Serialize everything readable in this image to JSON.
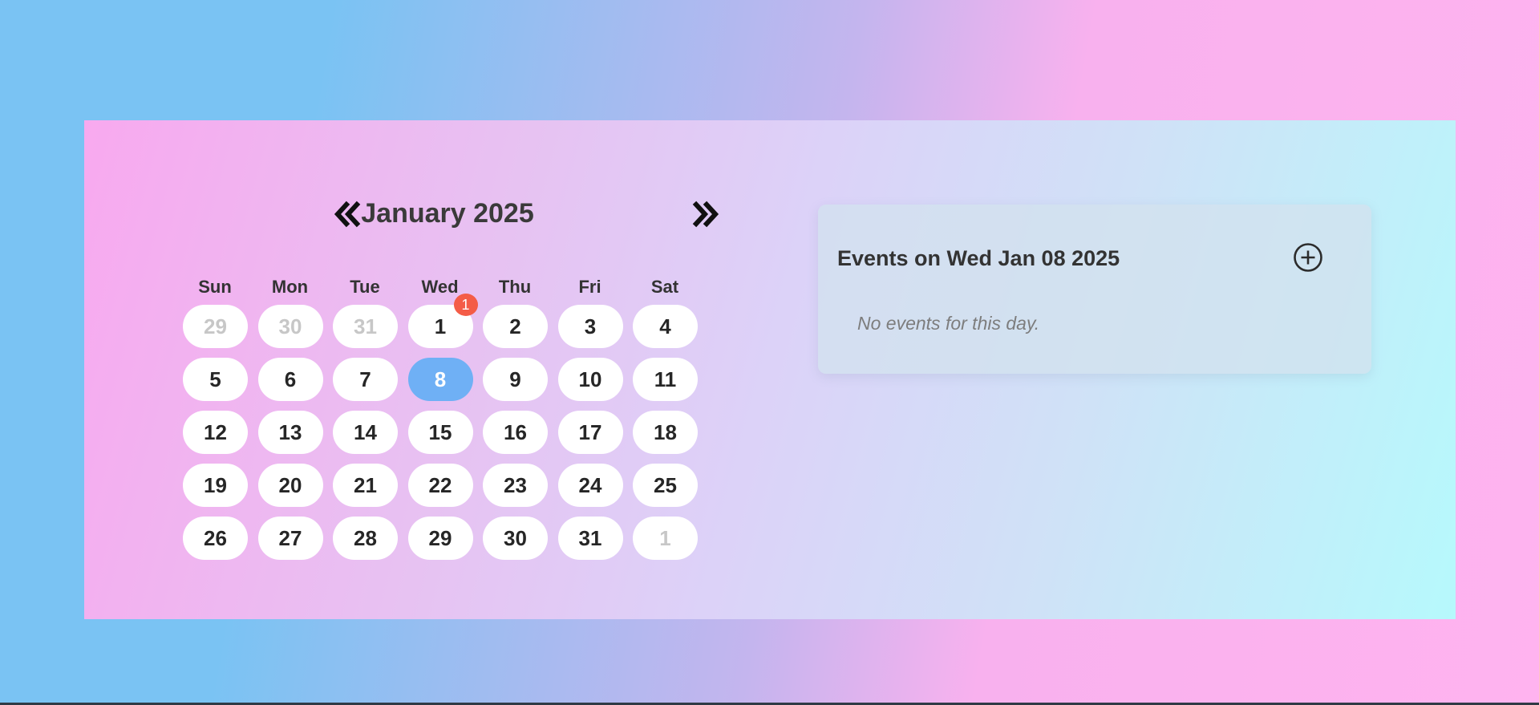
{
  "calendar": {
    "month_title": "January 2025",
    "weekdays": [
      "Sun",
      "Mon",
      "Tue",
      "Wed",
      "Thu",
      "Fri",
      "Sat"
    ],
    "weeks": [
      [
        {
          "n": "29",
          "muted": true
        },
        {
          "n": "30",
          "muted": true
        },
        {
          "n": "31",
          "muted": true
        },
        {
          "n": "1",
          "badge": "1"
        },
        {
          "n": "2"
        },
        {
          "n": "3"
        },
        {
          "n": "4"
        }
      ],
      [
        {
          "n": "5"
        },
        {
          "n": "6"
        },
        {
          "n": "7"
        },
        {
          "n": "8",
          "selected": true
        },
        {
          "n": "9"
        },
        {
          "n": "10"
        },
        {
          "n": "11"
        }
      ],
      [
        {
          "n": "12"
        },
        {
          "n": "13"
        },
        {
          "n": "14"
        },
        {
          "n": "15"
        },
        {
          "n": "16"
        },
        {
          "n": "17"
        },
        {
          "n": "18"
        }
      ],
      [
        {
          "n": "19"
        },
        {
          "n": "20"
        },
        {
          "n": "21"
        },
        {
          "n": "22"
        },
        {
          "n": "23"
        },
        {
          "n": "24"
        },
        {
          "n": "25"
        }
      ],
      [
        {
          "n": "26"
        },
        {
          "n": "27"
        },
        {
          "n": "28"
        },
        {
          "n": "29"
        },
        {
          "n": "30"
        },
        {
          "n": "31"
        },
        {
          "n": "1",
          "muted": true
        }
      ]
    ],
    "prev_icon": "double-chevron-left-icon",
    "next_icon": "double-chevron-right-icon"
  },
  "events": {
    "title": "Events on Wed Jan 08 2025",
    "empty_message": "No events for this day.",
    "add_icon": "plus-circle-icon"
  },
  "colors": {
    "selected_day": "#6fb0f5",
    "badge": "#f45c47",
    "muted_day_text": "#c7c7c7"
  }
}
